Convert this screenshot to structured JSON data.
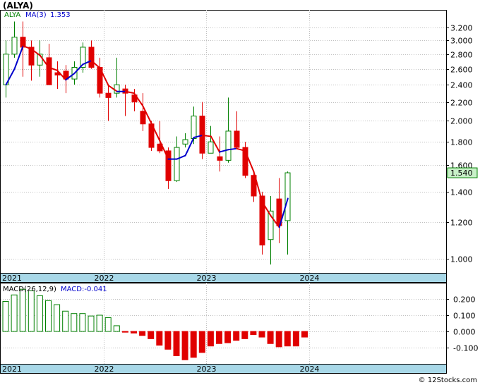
{
  "title": "(ALYA)",
  "watermark": "© 12Stocks.com",
  "colors": {
    "up": "#008000",
    "down": "#e00000",
    "ma_up": "#0000cc",
    "ma_down": "#e00000",
    "axis_band": "#a8d8e8",
    "grid": "#c0c0c0",
    "last_price_bg": "#c8f0c8",
    "macd_legend": "#0000cc"
  },
  "chart_data": [
    {
      "type": "candlestick",
      "name": "price",
      "legend": {
        "ticker": "ALYA",
        "ma_label": "MA(3)",
        "ma_value": "1.353"
      },
      "last_price": "1.540",
      "y_scale": "log",
      "ylim": [
        0.93,
        3.5
      ],
      "y_ticks": [
        {
          "v": 3.2,
          "label": "3.200"
        },
        {
          "v": 3.0,
          "label": "3.000"
        },
        {
          "v": 2.8,
          "label": "2.800"
        },
        {
          "v": 2.6,
          "label": "2.600"
        },
        {
          "v": 2.4,
          "label": "2.400"
        },
        {
          "v": 2.2,
          "label": "2.200"
        },
        {
          "v": 2.0,
          "label": "2.000"
        },
        {
          "v": 1.8,
          "label": "1.800"
        },
        {
          "v": 1.6,
          "label": "1.600"
        },
        {
          "v": 1.4,
          "label": "1.400"
        },
        {
          "v": 1.2,
          "label": "1.200"
        },
        {
          "v": 1.0,
          "label": "1.000"
        }
      ],
      "x_labels": [
        {
          "i": 0,
          "label": "2021"
        },
        {
          "i": 12,
          "label": "2022"
        },
        {
          "i": 24,
          "label": "2023"
        },
        {
          "i": 36,
          "label": "2024"
        }
      ],
      "candles": [
        {
          "o": 2.4,
          "h": 3.0,
          "l": 2.25,
          "c": 2.8
        },
        {
          "o": 2.8,
          "h": 3.3,
          "l": 2.75,
          "c": 3.05
        },
        {
          "o": 3.05,
          "h": 3.3,
          "l": 2.5,
          "c": 2.9
        },
        {
          "o": 2.9,
          "h": 3.0,
          "l": 2.45,
          "c": 2.65
        },
        {
          "o": 2.65,
          "h": 3.0,
          "l": 2.5,
          "c": 2.8
        },
        {
          "o": 2.75,
          "h": 2.95,
          "l": 2.4,
          "c": 2.4
        },
        {
          "o": 2.55,
          "h": 2.7,
          "l": 2.35,
          "c": 2.52
        },
        {
          "o": 2.57,
          "h": 2.65,
          "l": 2.3,
          "c": 2.47
        },
        {
          "o": 2.47,
          "h": 2.7,
          "l": 2.4,
          "c": 2.62
        },
        {
          "o": 2.62,
          "h": 2.97,
          "l": 2.55,
          "c": 2.9
        },
        {
          "o": 2.9,
          "h": 3.0,
          "l": 2.6,
          "c": 2.62
        },
        {
          "o": 2.62,
          "h": 2.75,
          "l": 2.25,
          "c": 2.3
        },
        {
          "o": 2.3,
          "h": 2.4,
          "l": 2.0,
          "c": 2.25
        },
        {
          "o": 2.3,
          "h": 2.75,
          "l": 2.25,
          "c": 2.4
        },
        {
          "o": 2.35,
          "h": 2.4,
          "l": 2.05,
          "c": 2.3
        },
        {
          "o": 2.28,
          "h": 2.35,
          "l": 2.1,
          "c": 2.2
        },
        {
          "o": 2.1,
          "h": 2.3,
          "l": 1.9,
          "c": 1.97
        },
        {
          "o": 1.97,
          "h": 2.0,
          "l": 1.72,
          "c": 1.75
        },
        {
          "o": 1.78,
          "h": 2.0,
          "l": 1.7,
          "c": 1.72
        },
        {
          "o": 1.72,
          "h": 1.75,
          "l": 1.42,
          "c": 1.48
        },
        {
          "o": 1.48,
          "h": 1.85,
          "l": 1.47,
          "c": 1.75
        },
        {
          "o": 1.78,
          "h": 1.88,
          "l": 1.75,
          "c": 1.82
        },
        {
          "o": 1.83,
          "h": 2.15,
          "l": 1.78,
          "c": 2.05
        },
        {
          "o": 2.05,
          "h": 2.2,
          "l": 1.65,
          "c": 1.7
        },
        {
          "o": 1.7,
          "h": 1.95,
          "l": 1.7,
          "c": 1.8
        },
        {
          "o": 1.67,
          "h": 1.85,
          "l": 1.55,
          "c": 1.64
        },
        {
          "o": 1.64,
          "h": 2.25,
          "l": 1.62,
          "c": 1.9
        },
        {
          "o": 1.9,
          "h": 2.1,
          "l": 1.75,
          "c": 1.75
        },
        {
          "o": 1.75,
          "h": 1.8,
          "l": 1.5,
          "c": 1.52
        },
        {
          "o": 1.52,
          "h": 1.55,
          "l": 1.33,
          "c": 1.37
        },
        {
          "o": 1.37,
          "h": 1.4,
          "l": 1.02,
          "c": 1.07
        },
        {
          "o": 1.1,
          "h": 1.37,
          "l": 0.97,
          "c": 1.27
        },
        {
          "o": 1.35,
          "h": 1.5,
          "l": 1.08,
          "c": 1.18
        },
        {
          "o": 1.21,
          "h": 1.55,
          "l": 1.02,
          "c": 1.54
        }
      ],
      "ma": [
        2.4,
        2.6,
        2.92,
        2.87,
        2.78,
        2.62,
        2.58,
        2.46,
        2.54,
        2.66,
        2.71,
        2.61,
        2.39,
        2.32,
        2.32,
        2.3,
        2.16,
        1.98,
        1.81,
        1.65,
        1.65,
        1.68,
        1.84,
        1.86,
        1.85,
        1.71,
        1.73,
        1.74,
        1.72,
        1.55,
        1.33,
        1.24,
        1.17,
        1.353
      ]
    },
    {
      "type": "bar",
      "name": "macd",
      "legend": {
        "label": "MACD(26,12,9)",
        "value_label": "MACD:-0.041"
      },
      "ylim": [
        -0.2,
        0.3
      ],
      "y_ticks": [
        {
          "v": 0.2,
          "label": "0.200"
        },
        {
          "v": 0.1,
          "label": "0.100"
        },
        {
          "v": 0.0,
          "label": "0.000"
        },
        {
          "v": -0.1,
          "label": "-0.100"
        }
      ],
      "x_labels": [
        {
          "i": 0,
          "label": "2021"
        },
        {
          "i": 12,
          "label": "2022"
        },
        {
          "i": 24,
          "label": "2023"
        },
        {
          "i": 36,
          "label": "2024"
        }
      ],
      "values": [
        0.185,
        0.225,
        0.26,
        0.25,
        0.22,
        0.19,
        0.165,
        0.125,
        0.11,
        0.11,
        0.095,
        0.1,
        0.085,
        0.035,
        -0.005,
        -0.01,
        -0.025,
        -0.045,
        -0.085,
        -0.11,
        -0.15,
        -0.175,
        -0.16,
        -0.13,
        -0.09,
        -0.075,
        -0.07,
        -0.055,
        -0.045,
        -0.02,
        -0.035,
        -0.075,
        -0.095,
        -0.09,
        -0.09,
        -0.035
      ]
    }
  ]
}
